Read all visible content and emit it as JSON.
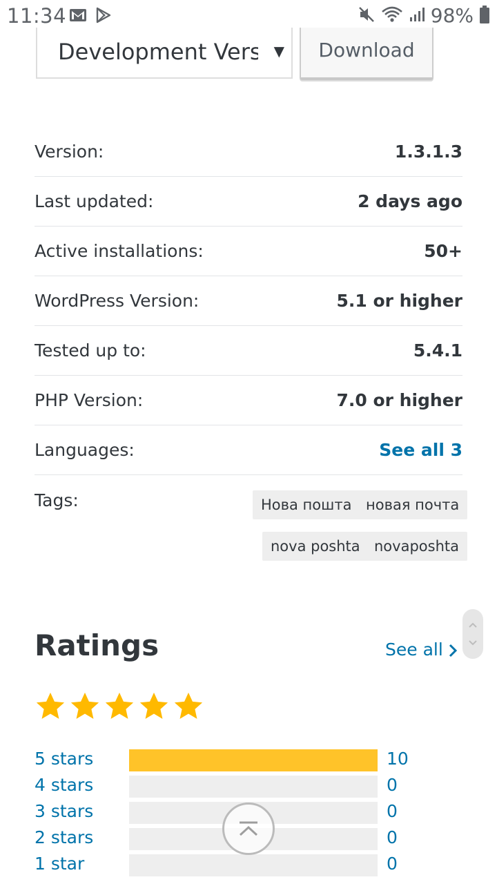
{
  "status_bar": {
    "time": "11:34",
    "battery": "98%",
    "icons": [
      "gmail-icon",
      "play-store-icon",
      "mute-icon",
      "wifi-icon",
      "signal-icon",
      "battery-icon"
    ]
  },
  "download_section": {
    "selected_version": "Development Version",
    "download_label": "Download"
  },
  "meta": [
    {
      "label": "Version:",
      "value": "1.3.1.3"
    },
    {
      "label": "Last updated:",
      "value": "2 days ago"
    },
    {
      "label": "Active installations:",
      "value": "50+"
    },
    {
      "label": "WordPress Version:",
      "value": "5.1 or higher"
    },
    {
      "label": "Tested up to:",
      "value": "5.4.1"
    },
    {
      "label": "PHP Version:",
      "value": "7.0 or higher"
    },
    {
      "label": "Languages:",
      "value": "See all 3"
    }
  ],
  "tags": {
    "label": "Tags:",
    "items": [
      "Нова пошта",
      "новая почта",
      "nova poshta",
      "novaposhta"
    ]
  },
  "ratings": {
    "title": "Ratings",
    "see_all": "See all",
    "average_stars": 5,
    "max_stars": 5,
    "breakdown": [
      {
        "label": "5 stars",
        "count": "10",
        "fraction": 1.0
      },
      {
        "label": "4 stars",
        "count": "0",
        "fraction": 0
      },
      {
        "label": "3 stars",
        "count": "0",
        "fraction": 0
      },
      {
        "label": "2 stars",
        "count": "0",
        "fraction": 0
      },
      {
        "label": "1 star",
        "count": "0",
        "fraction": 0
      }
    ]
  },
  "colors": {
    "link": "#0073aa",
    "star": "#ffb900",
    "bar_fill": "#ffc329",
    "bar_empty": "#eeeeee",
    "text": "#32373c"
  }
}
